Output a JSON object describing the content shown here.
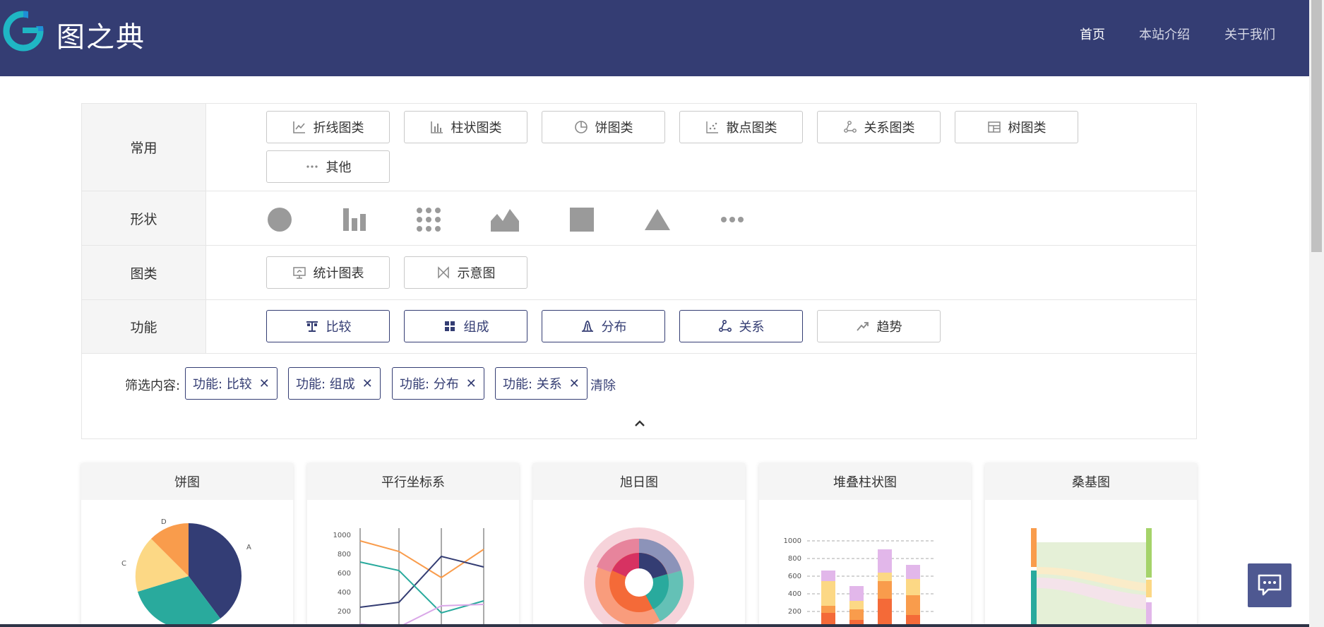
{
  "header": {
    "logo_text": "图之典",
    "nav": [
      "首页",
      "本站介绍",
      "关于我们"
    ]
  },
  "filters": {
    "common": {
      "label": "常用",
      "items": [
        "折线图类",
        "柱状图类",
        "饼图类",
        "散点图类",
        "关系图类",
        "树图类",
        "其他"
      ],
      "icons": [
        "line-chart-icon",
        "bar-chart-icon",
        "pie-chart-icon",
        "scatter-icon",
        "relation-icon",
        "treemap-icon",
        "more-icon"
      ]
    },
    "shape": {
      "label": "形状",
      "icons": [
        "circle-shape-icon",
        "bars-shape-icon",
        "dots-shape-icon",
        "area-shape-icon",
        "square-shape-icon",
        "triangle-shape-icon",
        "more-shape-icon"
      ]
    },
    "chart_kind": {
      "label": "图类",
      "items": [
        "统计图表",
        "示意图"
      ],
      "icons": [
        "statistics-chart-icon",
        "schematic-icon"
      ]
    },
    "function": {
      "label": "功能",
      "items": [
        "比较",
        "组成",
        "分布",
        "关系",
        "趋势"
      ],
      "active": [
        true,
        true,
        true,
        true,
        false
      ],
      "icons": [
        "balance-icon",
        "composition-icon",
        "distribution-icon",
        "relation-icon",
        "trend-icon"
      ]
    },
    "selected_label": "筛选内容:",
    "selected": [
      "功能: 比较",
      "功能: 组成",
      "功能: 分布",
      "功能: 关系"
    ],
    "clear": "清除",
    "remove_glyph": "✕"
  },
  "cards": [
    {
      "title": "饼图"
    },
    {
      "title": "平行坐标系"
    },
    {
      "title": "旭日图"
    },
    {
      "title": "堆叠柱状图"
    },
    {
      "title": "桑基图"
    }
  ],
  "pie_preview": {
    "labels": [
      "A",
      "C",
      "D"
    ]
  },
  "parallel_preview": {
    "ticks": [
      "1000",
      "800",
      "600",
      "400",
      "200"
    ]
  },
  "stacked_preview": {
    "ticks": [
      "1000",
      "800",
      "600",
      "400",
      "200"
    ]
  },
  "colors": {
    "header": "#343d73",
    "active": "#343d73",
    "chat": "#4e5891"
  }
}
